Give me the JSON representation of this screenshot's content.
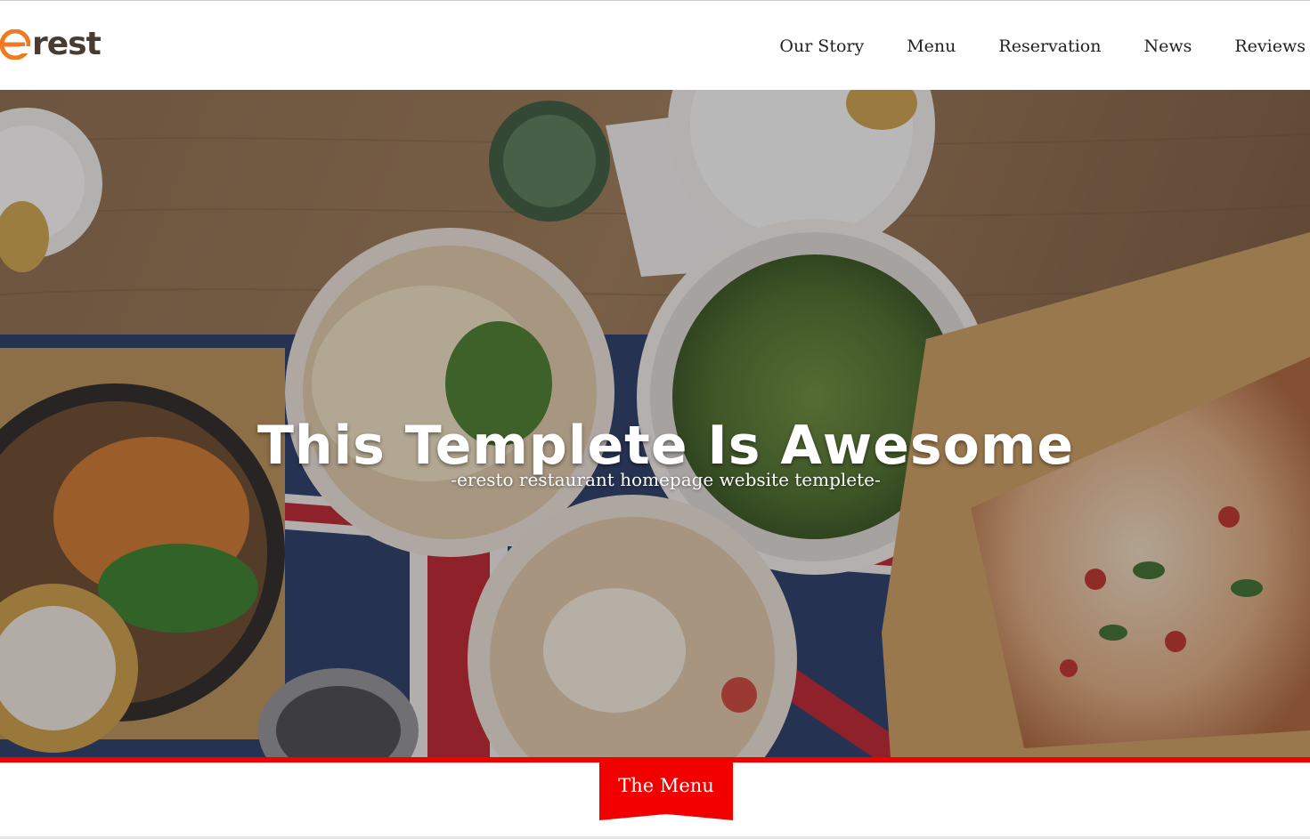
{
  "brand": {
    "logo_text": "rest",
    "logo_color": "#f07a1f",
    "text_color": "#4a3b30"
  },
  "nav": {
    "items": [
      {
        "label": "Our Story"
      },
      {
        "label": "Menu"
      },
      {
        "label": "Reservation"
      },
      {
        "label": "News"
      },
      {
        "label": "Reviews"
      }
    ]
  },
  "hero": {
    "title": "This Templete Is Awesome",
    "subtitle": "-eresto restaurant homepage website templete-",
    "image": "restaurant-table-food-photo"
  },
  "section_tab": {
    "label": "The Menu",
    "accent_color": "#f20000"
  }
}
